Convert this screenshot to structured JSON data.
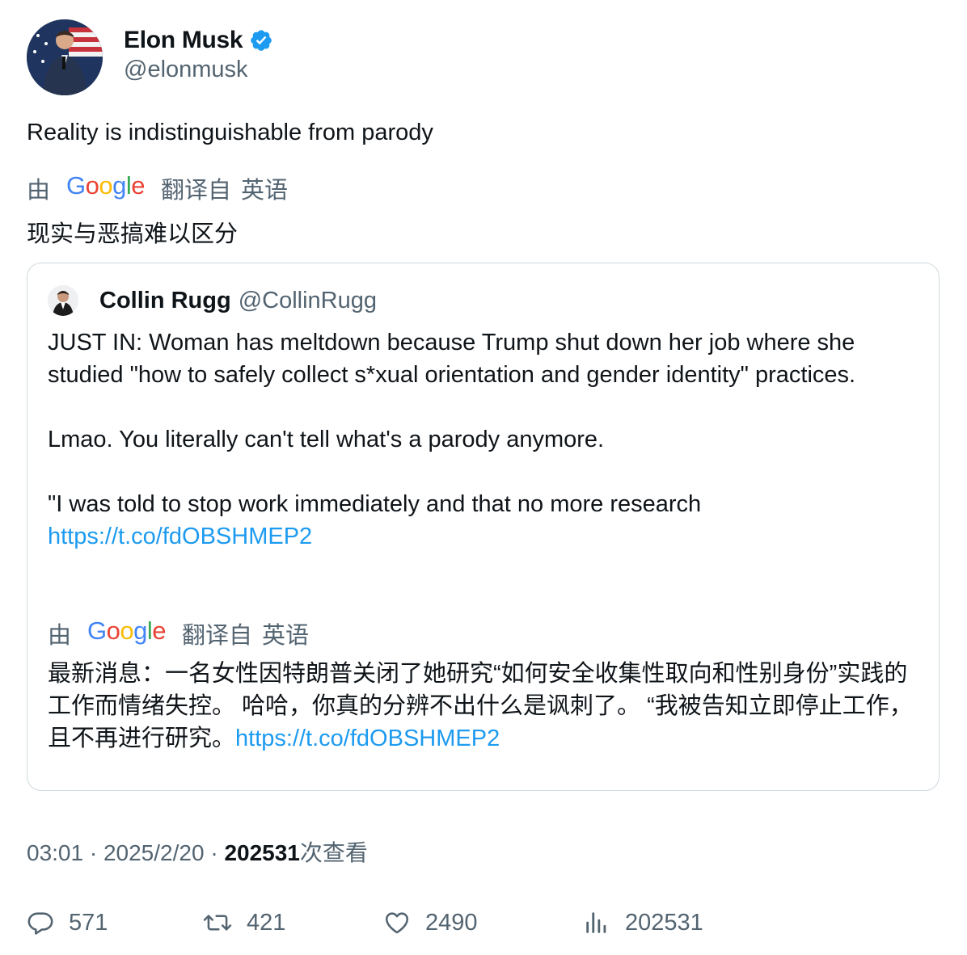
{
  "author": {
    "name": "Elon Musk",
    "handle": "@elonmusk"
  },
  "tweet": {
    "text": "Reality is indistinguishable from parody",
    "translate": {
      "by": "由",
      "google_letters": [
        "G",
        "o",
        "o",
        "g",
        "l",
        "e"
      ],
      "from": "翻译自",
      "lang": "英语"
    },
    "translated_text": "现实与恶搞难以区分"
  },
  "quote": {
    "name": "Collin Rugg",
    "handle": "@CollinRugg",
    "paragraph1": "JUST IN: Woman has meltdown because Trump shut down her job where she studied \"how to safely collect s*xual orientation and gender identity\" practices.",
    "paragraph2": "Lmao. You literally can't tell what's a parody anymore.",
    "paragraph3": "\"I was told to stop work immediately and that no more research",
    "link": "https://t.co/fdOBSHMEP2",
    "translate": {
      "by": "由",
      "from": "翻译自",
      "lang": "英语"
    },
    "translated_text": "最新消息：一名女性因特朗普关闭了她研究“如何安全收集性取向和性别身份”实践的工作而情绪失控。 哈哈，你真的分辨不出什么是讽刺了。 “我被告知立即停止工作，且不再进行研究。",
    "translated_link": "https://t.co/fdOBSHMEP2"
  },
  "meta": {
    "time": "03:01",
    "separator": "·",
    "date": "2025/2/20",
    "views_count": "202531",
    "views_label": "次查看"
  },
  "actions": {
    "replies": "571",
    "retweets": "421",
    "likes": "2490",
    "views": "202531"
  },
  "colors": {
    "verified": "#1d9bf0",
    "link": "#1d9bf0",
    "secondary_text": "#536471",
    "primary_text": "#0f1419",
    "border": "#cfd9de"
  },
  "icons": {
    "reply": "reply-icon",
    "retweet": "retweet-icon",
    "like": "like-icon",
    "views": "views-icon",
    "verified": "verified-badge-icon"
  }
}
